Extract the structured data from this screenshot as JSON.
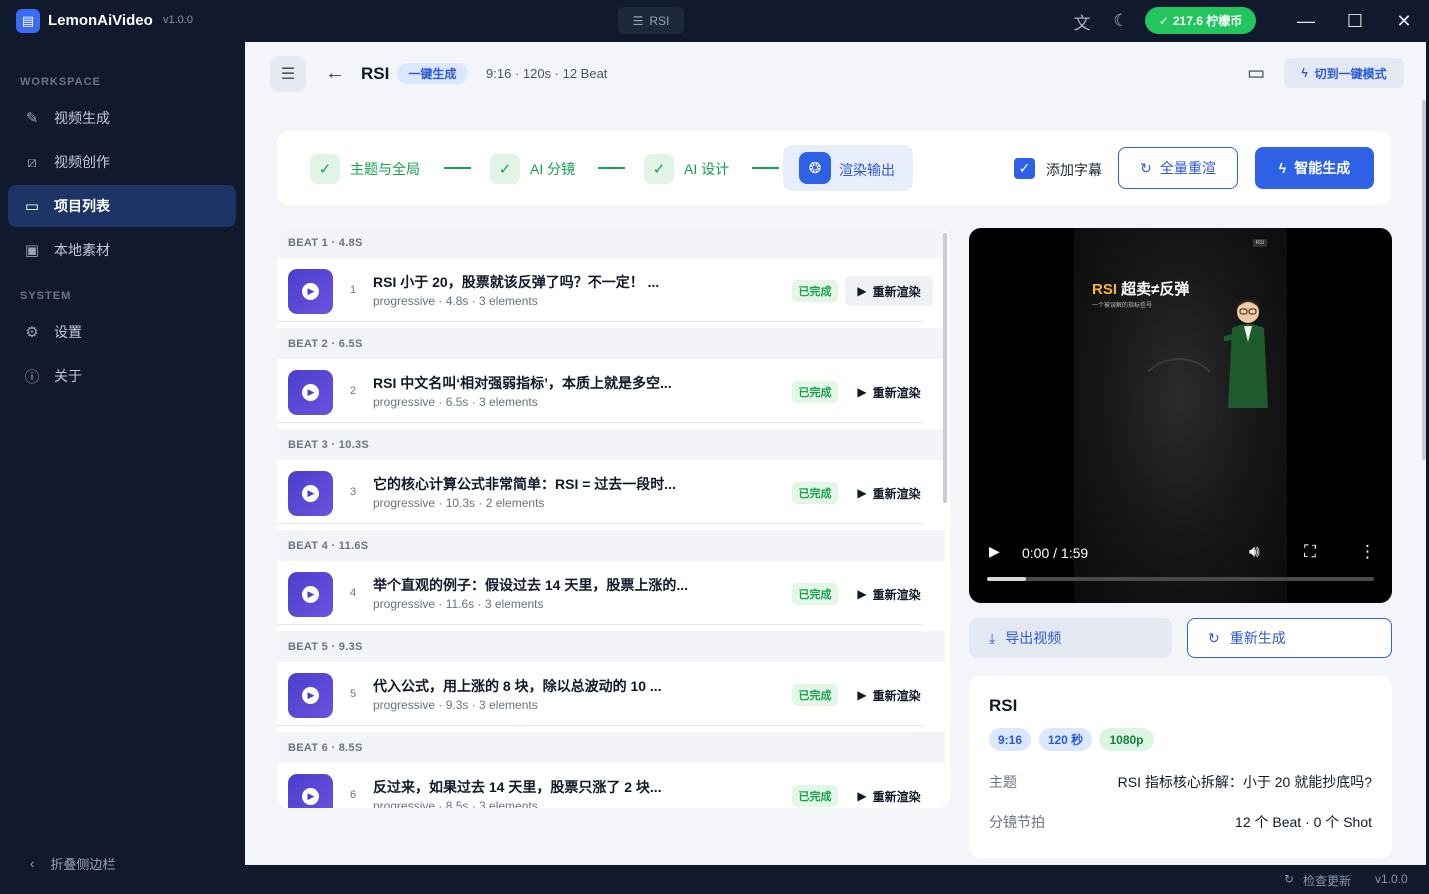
{
  "app": {
    "logo_glyph": "▤",
    "name": "LemonAiVideo",
    "version": "v1.0.0",
    "tab_label": "RSI",
    "coins": "217.6 柠檬币"
  },
  "sidebar": {
    "workspace_label": "WORKSPACE",
    "system_label": "SYSTEM",
    "items": [
      {
        "label": "视频生成",
        "icon": "magic-wand-icon"
      },
      {
        "label": "视频创作",
        "icon": "edit-icon"
      },
      {
        "label": "项目列表",
        "icon": "folder-icon"
      },
      {
        "label": "本地素材",
        "icon": "image-icon"
      },
      {
        "label": "设置",
        "icon": "gear-icon"
      },
      {
        "label": "关于",
        "icon": "info-icon"
      }
    ],
    "collapse_label": "折叠侧边栏"
  },
  "header": {
    "title": "RSI",
    "tag": "一键生成",
    "meta": "9:16 · 120s · 12 Beat",
    "switch_label": "切到一键模式"
  },
  "steps": [
    {
      "label": "主题与全局",
      "status": "done"
    },
    {
      "label": "AI 分镜",
      "status": "done"
    },
    {
      "label": "AI 设计",
      "status": "done"
    },
    {
      "label": "渲染输出",
      "status": "active"
    }
  ],
  "toolbar": {
    "subtitle_label": "添加字幕",
    "subtitle_checked": true,
    "rerender_all_label": "全量重渲",
    "smart_gen_label": "智能生成"
  },
  "beats": [
    {
      "header": "BEAT 1 · 4.8S",
      "num": "1",
      "title": "RSI 小于 20，股票就该反弹了吗？不一定！ ...",
      "sub": "progressive · 4.8s · 3 elements",
      "status": "已完成",
      "action": "重新渲染"
    },
    {
      "header": "BEAT 2 · 6.5S",
      "num": "2",
      "title": "RSI 中文名叫‘相对强弱指标’，本质上就是多空...",
      "sub": "progressive · 6.5s · 3 elements",
      "status": "已完成",
      "action": "重新渲染"
    },
    {
      "header": "BEAT 3 · 10.3S",
      "num": "3",
      "title": "它的核心计算公式非常简单：RSI = 过去一段时...",
      "sub": "progressive · 10.3s · 2 elements",
      "status": "已完成",
      "action": "重新渲染"
    },
    {
      "header": "BEAT 4 · 11.6S",
      "num": "4",
      "title": "举个直观的例子：假设过去 14 天里，股票上涨的...",
      "sub": "progressive · 11.6s · 3 elements",
      "status": "已完成",
      "action": "重新渲染"
    },
    {
      "header": "BEAT 5 · 9.3S",
      "num": "5",
      "title": "代入公式，用上涨的 8 块，除以总波动的 10 ...",
      "sub": "progressive · 9.3s · 3 elements",
      "status": "已完成",
      "action": "重新渲染"
    },
    {
      "header": "BEAT 6 · 8.5S",
      "num": "6",
      "title": "反过来，如果过去 14 天里，股票只涨了 2 块...",
      "sub": "progressive · 8.5s · 3 elements",
      "status": "已完成",
      "action": "重新渲染"
    }
  ],
  "video": {
    "frame_title_accent": "RSI",
    "frame_title_rest": " 超卖≠反弹",
    "frame_subtitle": "一个被误解的指标信号",
    "frame_tag": "RSI",
    "time": "0:00 / 1:59",
    "progress": 0.1
  },
  "actions": {
    "export_label": "导出视频",
    "regen_label": "重新生成"
  },
  "info": {
    "title": "RSI",
    "chips": [
      "9:16",
      "120 秒",
      "1080p"
    ],
    "theme_label": "主题",
    "theme_value": "RSI 指标核心拆解：小于 20 就能抄底吗?",
    "beats_label": "分镜节拍",
    "beats_value": "12 个 Beat · 0 个 Shot"
  },
  "statusbar": {
    "update_label": "检查更新",
    "version": "v1.0.0"
  }
}
